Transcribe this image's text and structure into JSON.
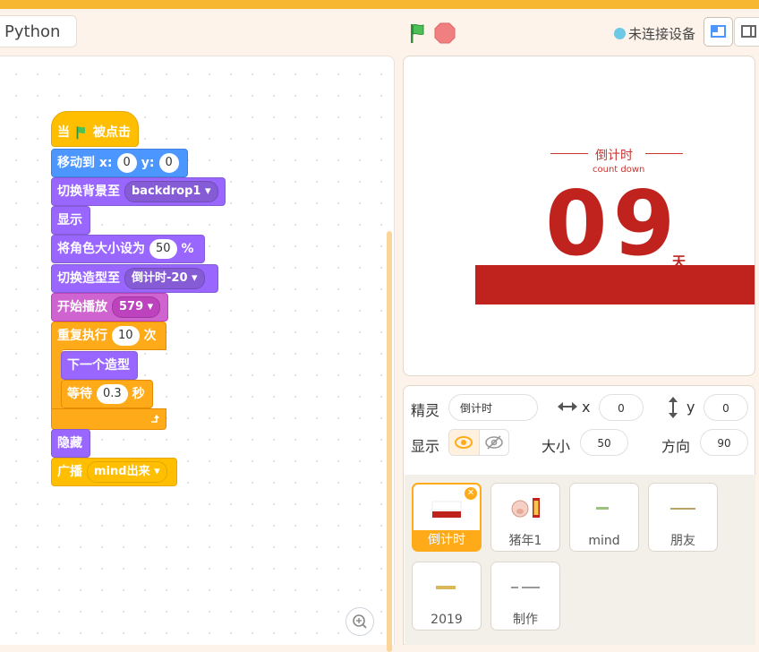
{
  "topbar": {
    "python_tab": "Python",
    "device_status": "未连接设备"
  },
  "colors": {
    "accent_orange": "#f7b731",
    "events": "#ffbf00",
    "motion": "#4c97ff",
    "looks": "#9966ff",
    "sound": "#cf63cf",
    "control": "#ffab19",
    "stage_red": "#c0231e"
  },
  "icons": {
    "green_flag": "green-flag-icon",
    "stop": "stop-icon",
    "zoom": "zoom-in-icon",
    "eye": "eye-icon",
    "eye_off": "eye-off-icon"
  },
  "script": {
    "hat": {
      "when": "当",
      "clicked": "被点击"
    },
    "goto": {
      "label": "移动到 x:",
      "x": "0",
      "y_label": "y:",
      "y": "0"
    },
    "switch_backdrop": {
      "label": "切换背景至",
      "value": "backdrop1"
    },
    "show": "显示",
    "set_size": {
      "label": "将角色大小设为",
      "value": "50",
      "unit": "%"
    },
    "switch_costume": {
      "label": "切换造型至",
      "value": "倒计时-20"
    },
    "start_sound": {
      "label": "开始播放",
      "value": "579"
    },
    "repeat": {
      "label": "重复执行",
      "value": "10",
      "unit": "次"
    },
    "next_costume": "下一个造型",
    "wait": {
      "label": "等待",
      "value": "0.3",
      "unit": "秒"
    },
    "hide": "隐藏",
    "broadcast": {
      "label": "广播",
      "value": "mind出来"
    }
  },
  "stage": {
    "title": "倒计时",
    "subtitle": "count down",
    "number": "09",
    "unit": "天"
  },
  "sprite_info": {
    "sprite_label": "精灵",
    "sprite_name": "倒计时",
    "x_label": "x",
    "x": "0",
    "y_label": "y",
    "y": "0",
    "show_label": "显示",
    "size_label": "大小",
    "size": "50",
    "direction_label": "方向",
    "direction": "90"
  },
  "sprites": [
    {
      "name": "倒计时",
      "selected": true
    },
    {
      "name": "猪年1",
      "selected": false
    },
    {
      "name": "mind",
      "selected": false
    },
    {
      "name": "朋友",
      "selected": false
    },
    {
      "name": "2019",
      "selected": false
    },
    {
      "name": "制作",
      "selected": false
    }
  ]
}
